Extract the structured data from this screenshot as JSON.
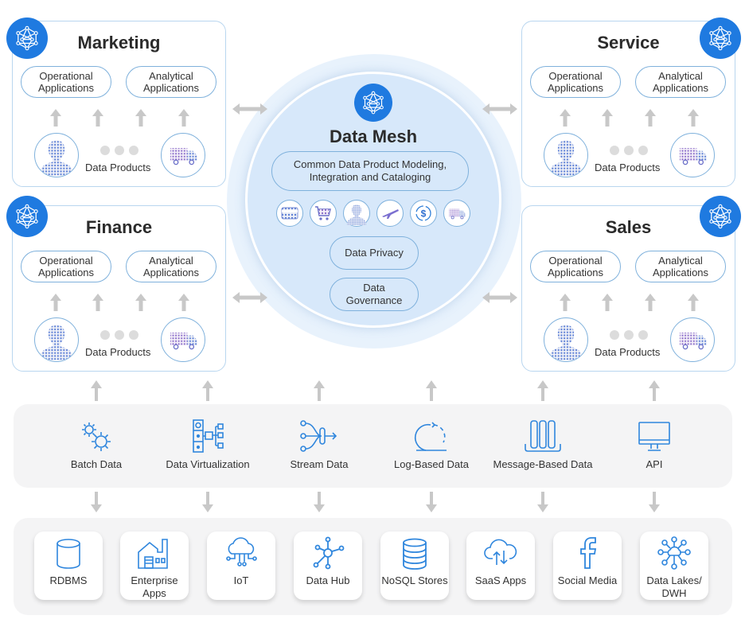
{
  "colors": {
    "accent": "#1f7ae0",
    "border": "#7fb1dc",
    "arrow": "#c8c8c8",
    "mesh_bg": "#d7e8fa",
    "band_bg": "#f4f4f5"
  },
  "domains": [
    {
      "title": "Marketing",
      "op_app": "Operational Applications",
      "an_app": "Analytical Applications",
      "products_label": "Data Products",
      "badge_icon": "mesh-network-icon"
    },
    {
      "title": "Finance",
      "op_app": "Operational Applications",
      "an_app": "Analytical Applications",
      "products_label": "Data Products",
      "badge_icon": "mesh-network-icon"
    },
    {
      "title": "Service",
      "op_app": "Operational Applications",
      "an_app": "Analytical Applications",
      "products_label": "Data Products",
      "badge_icon": "mesh-network-icon"
    },
    {
      "title": "Sales",
      "op_app": "Operational Applications",
      "an_app": "Analytical Applications",
      "products_label": "Data Products",
      "badge_icon": "mesh-network-icon"
    }
  ],
  "mesh": {
    "title": "Data Mesh",
    "modeling": "Common Data Product Modeling, Integration and Cataloging",
    "product_icons": [
      "credit-card-icon",
      "shopping-cart-icon",
      "person-icon",
      "airplane-icon",
      "dollar-cycle-icon",
      "delivery-truck-icon"
    ],
    "privacy": "Data Privacy",
    "governance": "Data Governance"
  },
  "integration_methods": [
    {
      "label": "Batch Data",
      "icon": "gears-icon"
    },
    {
      "label": "Data Virtualization",
      "icon": "virtualization-icon"
    },
    {
      "label": "Stream Data",
      "icon": "stream-icon"
    },
    {
      "label": "Log-Based Data",
      "icon": "log-cycle-icon"
    },
    {
      "label": "Message-Based Data",
      "icon": "message-queue-icon"
    },
    {
      "label": "API",
      "icon": "monitor-icon"
    }
  ],
  "sources": [
    {
      "label": "RDBMS",
      "icon": "database-cylinder-icon"
    },
    {
      "label": "Enterprise Apps",
      "icon": "factory-icon"
    },
    {
      "label": "IoT",
      "icon": "cloud-circuit-icon"
    },
    {
      "label": "Data Hub",
      "icon": "hub-network-icon"
    },
    {
      "label": "NoSQL Stores",
      "icon": "stacked-database-icon"
    },
    {
      "label": "SaaS Apps",
      "icon": "cloud-sync-icon"
    },
    {
      "label": "Social Media",
      "icon": "facebook-icon"
    },
    {
      "label": "Data Lakes/ DWH",
      "icon": "data-lake-icon"
    }
  ]
}
